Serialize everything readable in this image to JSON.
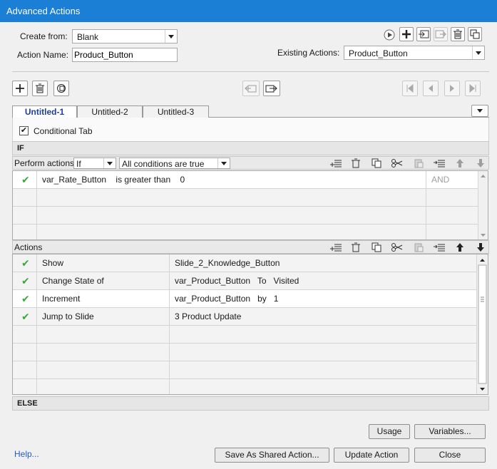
{
  "window": {
    "title": "Advanced Actions"
  },
  "form": {
    "create_from_label": "Create from:",
    "create_from_value": "Blank",
    "action_name_label": "Action Name:",
    "action_name_value": "Product_Button",
    "existing_actions_label": "Existing Actions:",
    "existing_actions_value": "Product_Button"
  },
  "tabs": [
    {
      "label": "Untitled-1",
      "active": true
    },
    {
      "label": "Untitled-2",
      "active": false
    },
    {
      "label": "Untitled-3",
      "active": false
    }
  ],
  "conditional": {
    "label": "Conditional Tab",
    "checked": true
  },
  "if_section": {
    "header": "IF",
    "perform_label": "Perform actions:",
    "perform_value": "If",
    "conditions_value": "All conditions are true",
    "rows": [
      {
        "variable": "var_Rate_Button",
        "operator": "is greater than",
        "value": "0",
        "logic": "AND"
      }
    ]
  },
  "actions_section": {
    "header": "Actions",
    "rows": [
      {
        "action": "Show",
        "target": "Slide_2_Knowledge_Button"
      },
      {
        "action": "Change State of",
        "target": "var_Product_Button   To   Visited"
      },
      {
        "action": "Increment",
        "target": "var_Product_Button   by   1"
      },
      {
        "action": "Jump to Slide",
        "target": "3 Product Update"
      }
    ]
  },
  "else_section": {
    "header": "ELSE"
  },
  "buttons": {
    "usage": "Usage",
    "variables": "Variables...",
    "help": "Help...",
    "save_shared": "Save As Shared Action...",
    "update": "Update Action",
    "close": "Close"
  },
  "colors": {
    "titlebar": "#1b7fd6",
    "check": "#3aa83a",
    "tab_active_text": "#1a3fa0"
  }
}
